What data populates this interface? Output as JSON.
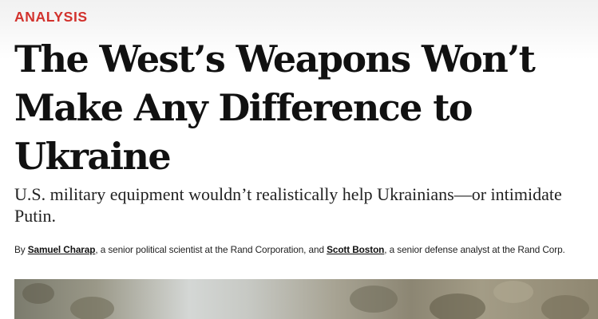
{
  "article": {
    "kicker": "ANALYSIS",
    "headline": "The West’s Weapons Won’t Make Any Difference to Ukraine",
    "deck": "U.S. military equipment wouldn’t realistically help Ukrainians—or intimidate Putin.",
    "byline": {
      "prefix": "By ",
      "author1": "Samuel Charap",
      "author1_desc": ", a senior political scientist at the Rand Corporation, and ",
      "author2": "Scott Boston",
      "author2_desc": ", a senior defense analyst at the Rand Corp."
    }
  }
}
